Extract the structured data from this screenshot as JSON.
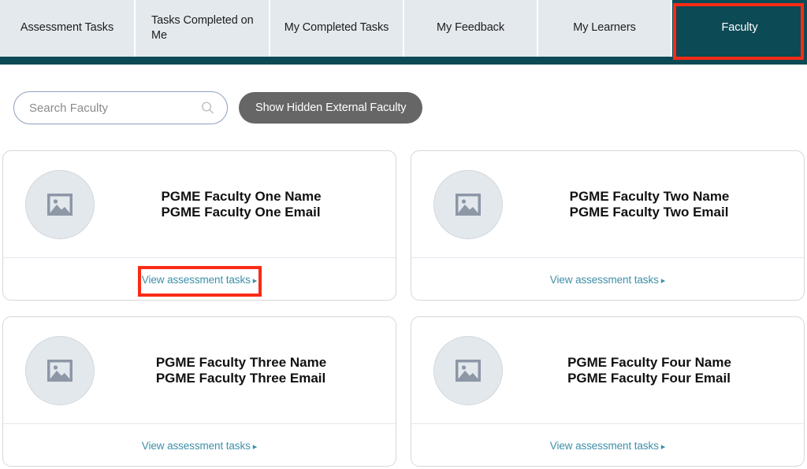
{
  "tabs": [
    {
      "label": "Assessment Tasks",
      "active": false
    },
    {
      "label": "Tasks Completed on Me",
      "active": false
    },
    {
      "label": "My Completed Tasks",
      "active": false
    },
    {
      "label": "My Feedback",
      "active": false
    },
    {
      "label": "My Learners",
      "active": false
    },
    {
      "label": "Faculty",
      "active": true
    }
  ],
  "toolbar": {
    "search_placeholder": "Search Faculty",
    "search_value": "",
    "search_icon": "search-icon",
    "show_hidden_label": "Show Hidden External Faculty"
  },
  "cards": [
    {
      "name": "PGME Faculty One Name",
      "email": "PGME Faculty One Email",
      "avatar_icon": "image-placeholder-icon",
      "link_label": "View assessment tasks",
      "link_arrow": "▸",
      "highlighted": true
    },
    {
      "name": "PGME Faculty Two Name",
      "email": "PGME Faculty Two Email",
      "avatar_icon": "image-placeholder-icon",
      "link_label": "View assessment tasks",
      "link_arrow": "▸",
      "highlighted": false
    },
    {
      "name": "PGME Faculty Three Name",
      "email": "PGME Faculty Three Email",
      "avatar_icon": "image-placeholder-icon",
      "link_label": "View assessment tasks",
      "link_arrow": "▸",
      "highlighted": false
    },
    {
      "name": "PGME Faculty Four Name",
      "email": "PGME Faculty Four Email",
      "avatar_icon": "image-placeholder-icon",
      "link_label": "View assessment tasks",
      "link_arrow": "▸",
      "highlighted": false
    }
  ],
  "annotations": [
    {
      "target": "tab-faculty",
      "color": "#fb2b16"
    },
    {
      "target": "view-assessment-tasks-link-card-1",
      "color": "#fb2b16"
    }
  ],
  "colors": {
    "tab_bar_bg": "#e4e9ed",
    "active_tab_bg": "#0c4a55",
    "teal_strip": "#0c4a55",
    "link": "#3d8fa8",
    "button_gray": "#666666",
    "annotation_red": "#fb2b16",
    "avatar_bg": "#e3e8ed"
  }
}
